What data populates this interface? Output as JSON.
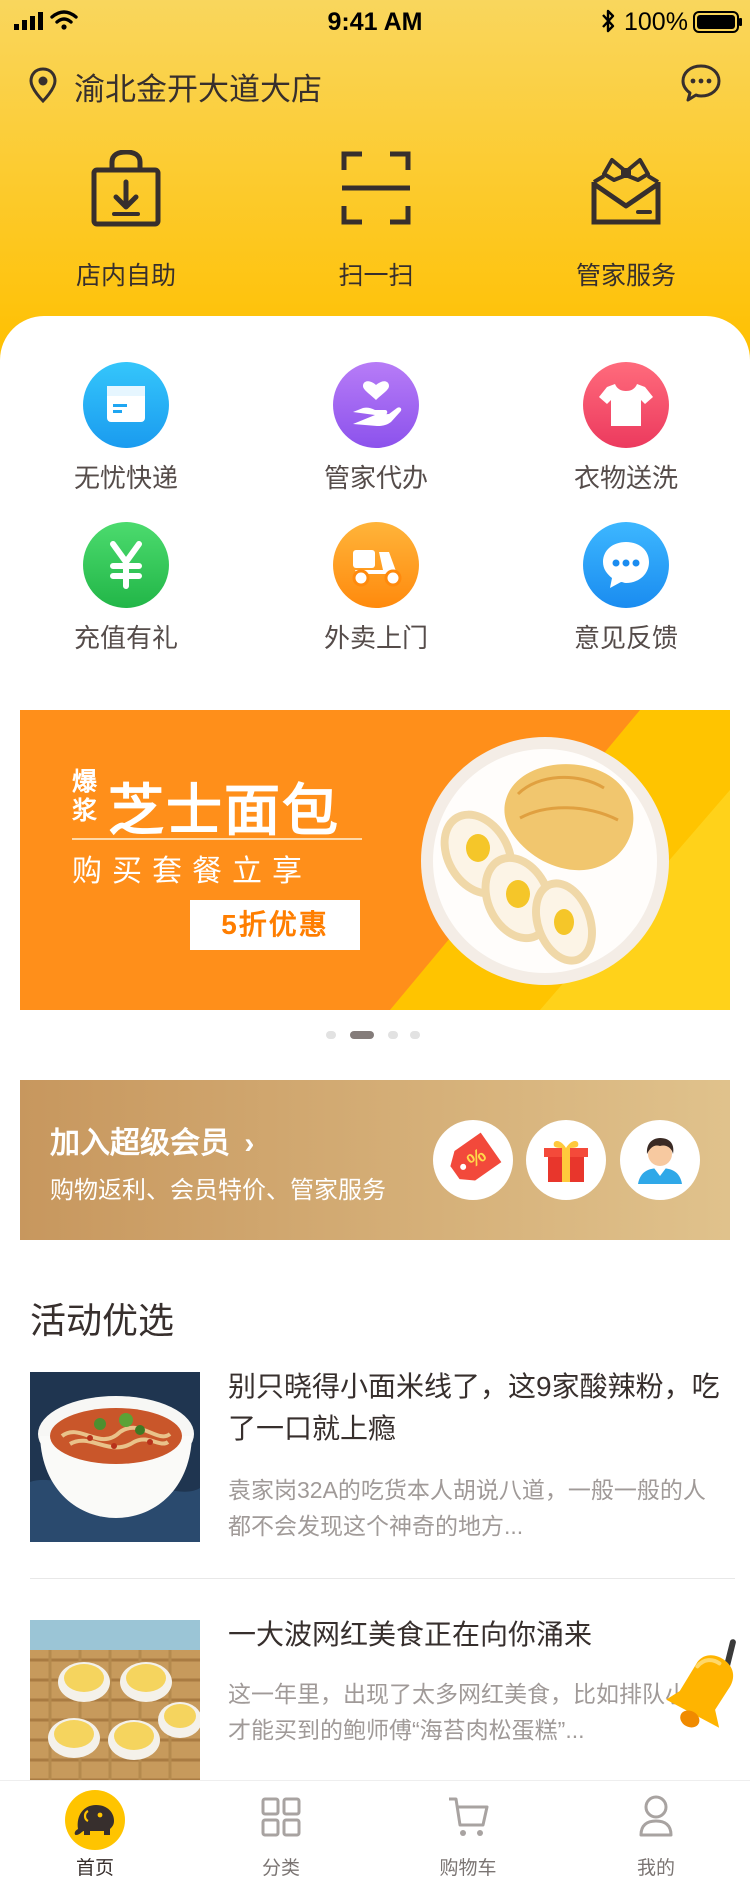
{
  "status_bar": {
    "time": "9:41 AM",
    "battery": "100%"
  },
  "header": {
    "location": "渝北金开大道大店",
    "actions": [
      {
        "id": "self-service",
        "label": "店内自助",
        "icon": "shopping-bag-icon"
      },
      {
        "id": "scan",
        "label": "扫一扫",
        "icon": "scan-icon"
      },
      {
        "id": "butler",
        "label": "管家服务",
        "icon": "bowtie-envelope-icon"
      }
    ]
  },
  "services": [
    {
      "label": "无忧快递",
      "icon": "parcel-icon",
      "color": "#2BB6F5"
    },
    {
      "label": "管家代办",
      "icon": "heart-hand-icon",
      "color": "#A56CF2"
    },
    {
      "label": "衣物送洗",
      "icon": "shirt-icon",
      "color": "#F4516C"
    },
    {
      "label": "充值有礼",
      "icon": "yen-icon",
      "color": "#36C95C"
    },
    {
      "label": "外卖上门",
      "icon": "scooter-icon",
      "color": "#FF9E1B"
    },
    {
      "label": "意见反馈",
      "icon": "chat-bubble-icon",
      "color": "#2BA6F5"
    }
  ],
  "banner": {
    "tag": "爆浆",
    "title": "芝士面包",
    "subtitle": "购买套餐立享",
    "promo": "5折优惠"
  },
  "carousel": {
    "count": 4,
    "active": 2
  },
  "member": {
    "title": "加入超级会员",
    "chevron": "›",
    "subtitle": "购物返利、会员特价、管家服务",
    "badges": [
      "discount-tag-icon",
      "gift-icon",
      "staff-icon"
    ]
  },
  "activities": {
    "title": "活动优选",
    "items": [
      {
        "title": "别只晓得小面米线了，这9家酸辣粉，吃了一口就上瘾",
        "desc": "袁家岗32A的吃货本人胡说八道，一般一般的人都不会发现这个神奇的地方...",
        "thumb": "noodle-bowl-image"
      },
      {
        "title": "一大波网红美食正在向你涌来",
        "desc": "这一年里，出现了太多网红美食，比如排队小时才能买到的鲍师傅“海苔肉松蛋糕”...",
        "thumb": "pudding-cups-image"
      }
    ]
  },
  "tabbar": [
    {
      "label": "首页",
      "icon": "elephant-icon",
      "active": true
    },
    {
      "label": "分类",
      "icon": "grid-icon",
      "active": false
    },
    {
      "label": "购物车",
      "icon": "cart-icon",
      "active": false
    },
    {
      "label": "我的",
      "icon": "user-icon",
      "active": false
    }
  ],
  "colors": {
    "header_top": "#F9D65D",
    "header_bottom": "#FFC000",
    "text_primary": "#372F2D",
    "text_secondary": "#A09A98",
    "divider": "#E8E8E8",
    "dot_active": "#847C7A",
    "dot_inactive": "#E2E2E2"
  }
}
